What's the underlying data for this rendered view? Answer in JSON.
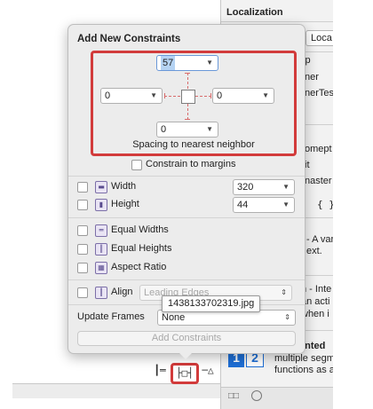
{
  "inspector": {
    "heading": "Localization",
    "local_popup": "Loca",
    "rows": [
      "ip",
      "ner",
      "nerTest",
      "omept",
      "it",
      "naster",
      "{ }",
      "- A var",
      "ext.",
      "n - Inte",
      "an acti",
      "when i",
      "ented",
      "multiple segm",
      "functions as a"
    ],
    "segment_left": "1",
    "segment_right": "2"
  },
  "toolbar": {
    "align_btn": "┃═",
    "pin_btn": "├□┤",
    "resolve_btn": "─△"
  },
  "popover": {
    "title": "Add New Constraints",
    "spacing": {
      "top": "57",
      "left": "0",
      "right": "0",
      "bottom": "0",
      "label": "Spacing to nearest neighbor"
    },
    "constrain_margins": "Constrain to margins",
    "width_label": "Width",
    "width_value": "320",
    "height_label": "Height",
    "height_value": "44",
    "equal_widths": "Equal Widths",
    "equal_heights": "Equal Heights",
    "aspect_ratio": "Aspect Ratio",
    "align_label": "Align",
    "align_value": "Leading Edges",
    "update_frames_label": "Update Frames",
    "update_frames_value": "None",
    "add_button": "Add Constraints"
  },
  "tooltip": "1438133702319.jpg",
  "colors": {
    "highlight": "#d23b3b",
    "selection": "#b5d3f3",
    "segment_blue": "#1e6fd6"
  }
}
